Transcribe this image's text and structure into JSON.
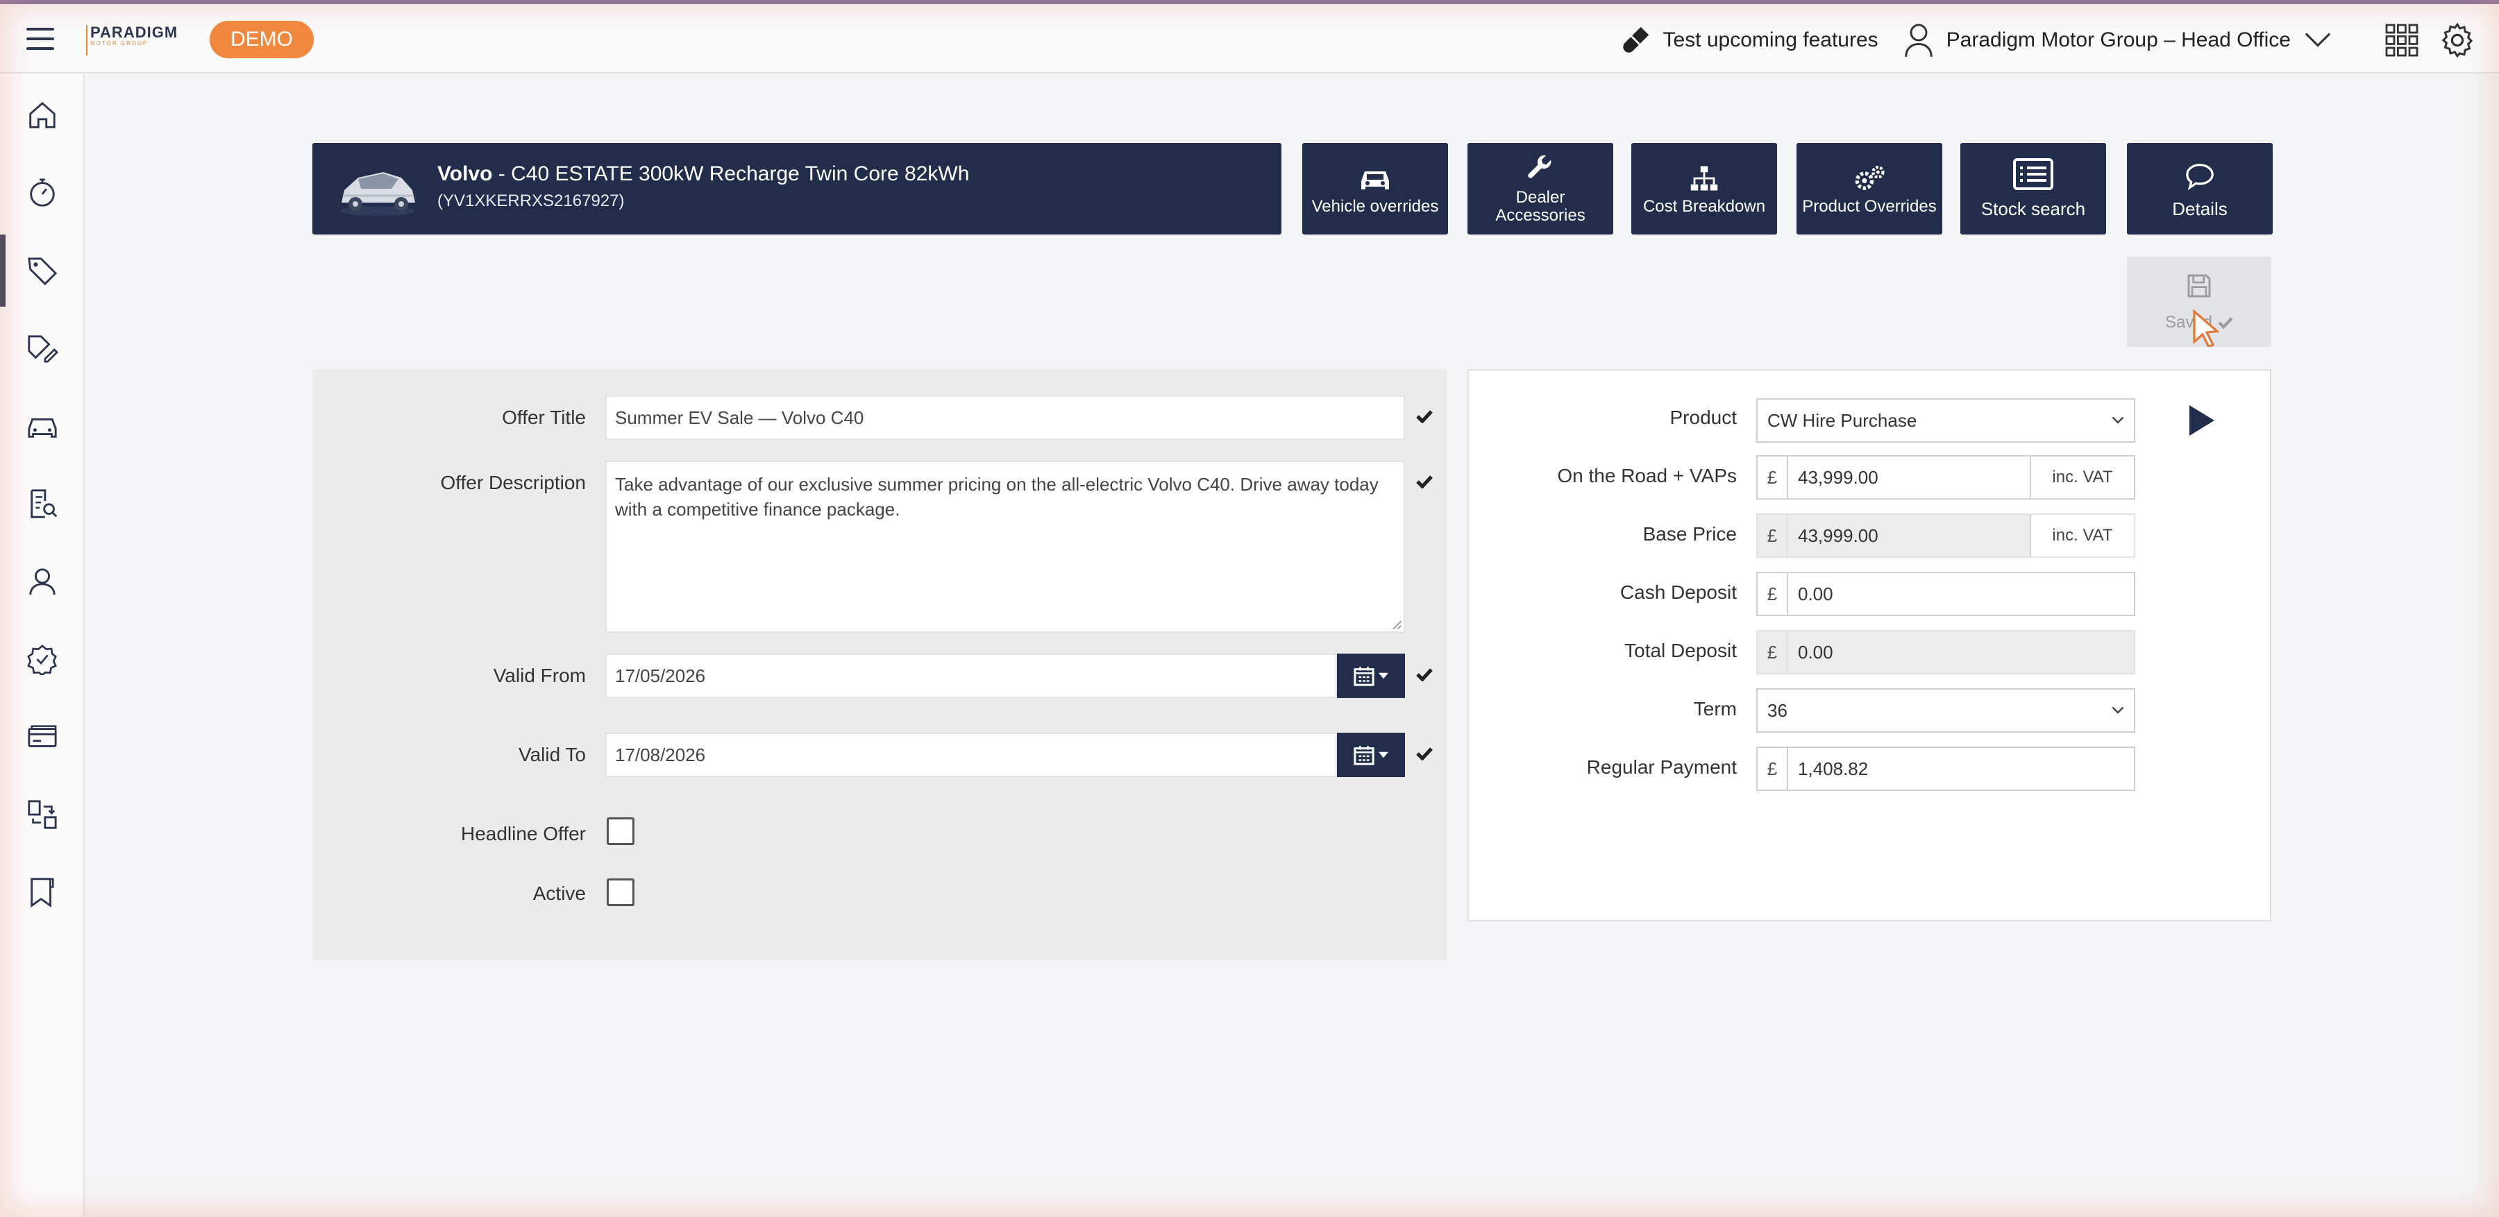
{
  "topbar": {
    "logo_main": "PARADIGM",
    "logo_sub": "MOTOR GROUP",
    "demo_badge": "DEMO",
    "test_features": "Test upcoming features",
    "org_name": "Paradigm Motor Group – Head Office"
  },
  "sidebar": {
    "items": [
      "home-icon",
      "stopwatch-icon",
      "tag-icon",
      "price-tag-edit-icon",
      "car-icon",
      "report-search-icon",
      "users-icon",
      "settings-badge-icon",
      "card-icon",
      "transfer-icon",
      "bookmark-icon"
    ],
    "active_index": 2
  },
  "vehicle": {
    "make": "Volvo",
    "model": " - C40 ESTATE 300kW Recharge Twin Core 82kWh",
    "vin": "(YV1XKERRXS2167927)"
  },
  "toolbar": {
    "vehicle_overrides": "Vehicle overrides",
    "dealer_accessories": "Dealer Accessories",
    "cost_breakdown": "Cost Breakdown",
    "product_overrides": "Product Overrides",
    "stock_search": "Stock search",
    "details": "Details",
    "saved": "Saved"
  },
  "offer": {
    "title_label": "Offer Title",
    "title_value": "Summer EV Sale — Volvo C40",
    "description_label": "Offer Description",
    "description_value": "Take advantage of our exclusive summer pricing on the all-electric Volvo C40. Drive away today with a competitive finance package.",
    "valid_from_label": "Valid From",
    "valid_from_value": "17/05/2026",
    "valid_to_label": "Valid To",
    "valid_to_value": "17/08/2026",
    "headline_label": "Headline Offer",
    "headline_checked": false,
    "active_label": "Active",
    "active_checked": false
  },
  "finance": {
    "product_label": "Product",
    "product_value": "CW Hire Purchase",
    "otr_label": "On the Road + VAPs",
    "otr_value": "43,999.00",
    "base_label": "Base Price",
    "base_value": "43,999.00",
    "cash_deposit_label": "Cash Deposit",
    "cash_deposit_value": "0.00",
    "total_deposit_label": "Total Deposit",
    "total_deposit_value": "0.00",
    "term_label": "Term",
    "term_value": "36",
    "regular_label": "Regular Payment",
    "regular_value": "1,408.82",
    "currency": "£",
    "vat_suffix": "inc. VAT"
  },
  "colors": {
    "navy": "#212d4a",
    "accent_orange": "#f0883e"
  }
}
